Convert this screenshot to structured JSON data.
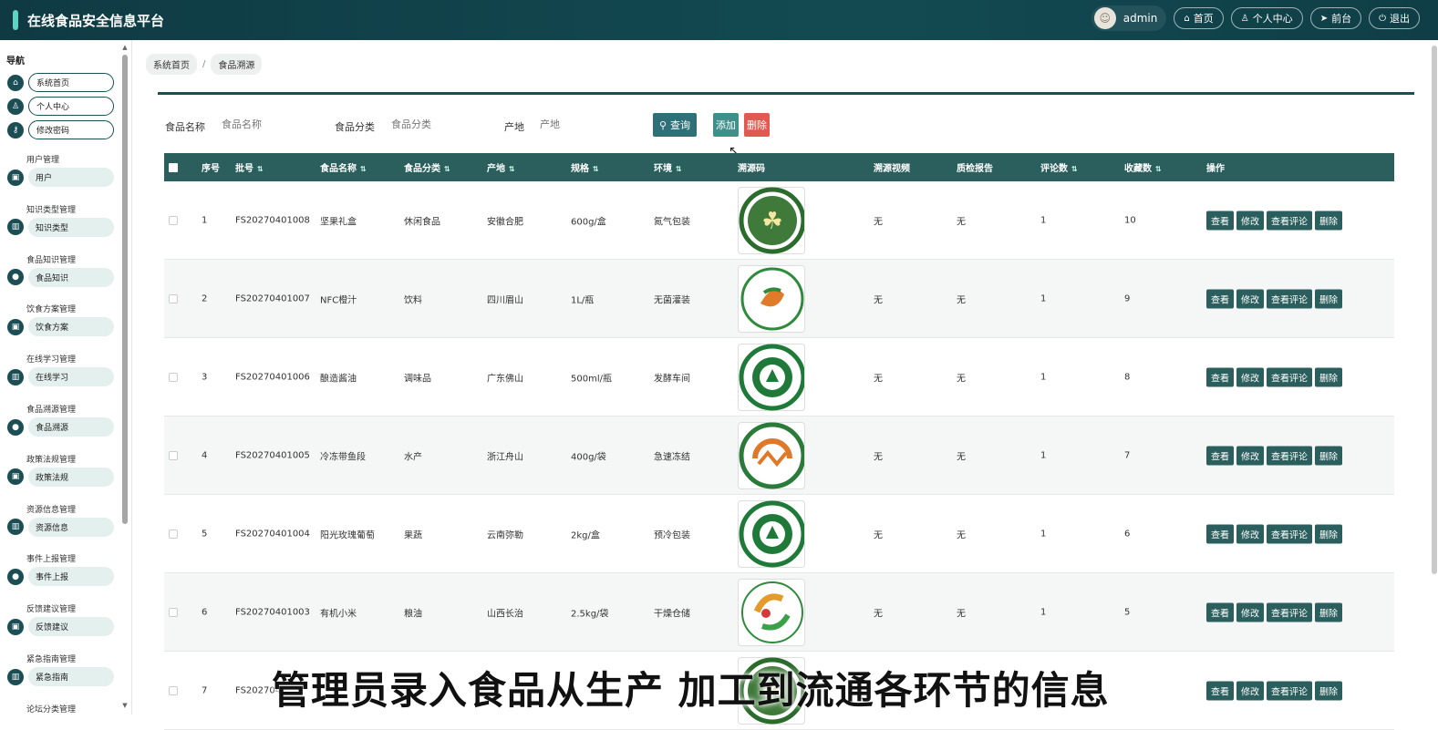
{
  "app": {
    "title": "在线食品安全信息平台"
  },
  "header": {
    "user": "admin",
    "buttons": [
      {
        "icon": "home-icon",
        "label": "首页"
      },
      {
        "icon": "user-icon",
        "label": "个人中心"
      },
      {
        "icon": "send-icon",
        "label": "前台"
      },
      {
        "icon": "power-icon",
        "label": "退出"
      }
    ]
  },
  "sidebar": {
    "title": "导航",
    "top_items": [
      "系统首页",
      "个人中心",
      "修改密码"
    ],
    "groups": [
      {
        "title": "用户管理",
        "item": "用户"
      },
      {
        "title": "知识类型管理",
        "item": "知识类型"
      },
      {
        "title": "食品知识管理",
        "item": "食品知识"
      },
      {
        "title": "饮食方案管理",
        "item": "饮食方案"
      },
      {
        "title": "在线学习管理",
        "item": "在线学习"
      },
      {
        "title": "食品溯源管理",
        "item": "食品溯源"
      },
      {
        "title": "政策法规管理",
        "item": "政策法规"
      },
      {
        "title": "资源信息管理",
        "item": "资源信息"
      },
      {
        "title": "事件上报管理",
        "item": "事件上报"
      },
      {
        "title": "反馈建议管理",
        "item": "反馈建议"
      },
      {
        "title": "紧急指南管理",
        "item": "紧急指南"
      },
      {
        "title": "论坛分类管理",
        "item": ""
      }
    ]
  },
  "breadcrumb": {
    "home": "系统首页",
    "sep": "/",
    "current": "食品溯源"
  },
  "filters": {
    "name_label": "食品名称",
    "name_placeholder": "食品名称",
    "category_label": "食品分类",
    "category_placeholder": "食品分类",
    "origin_label": "产地",
    "origin_placeholder": "产地",
    "query": "查询",
    "add": "添加",
    "delete": "删除"
  },
  "table": {
    "headers": [
      "序号",
      "批号",
      "食品名称",
      "食品分类",
      "产地",
      "规格",
      "环境",
      "溯源码",
      "溯源视频",
      "质检报告",
      "评论数",
      "收藏数",
      "操作"
    ],
    "ops": [
      "查看",
      "修改",
      "查看评论",
      "删除"
    ],
    "rows": [
      {
        "no": "1",
        "batch": "FS20270401008",
        "name": "坚果礼盒",
        "cat": "休闲食品",
        "origin": "安徽合肥",
        "spec": "600g/盒",
        "env": "氮气包装",
        "video": "无",
        "report": "无",
        "comments": "1",
        "favs": "10",
        "badge": "green-round"
      },
      {
        "no": "2",
        "batch": "FS20270401007",
        "name": "NFC橙汁",
        "cat": "饮料",
        "origin": "四川眉山",
        "spec": "1L/瓶",
        "env": "无菌灌装",
        "video": "无",
        "report": "无",
        "comments": "1",
        "favs": "9",
        "badge": "leaf"
      },
      {
        "no": "3",
        "batch": "FS20270401006",
        "name": "酿造酱油",
        "cat": "调味品",
        "origin": "广东佛山",
        "spec": "500ml/瓶",
        "env": "发酵车间",
        "video": "无",
        "report": "无",
        "comments": "1",
        "favs": "8",
        "badge": "emblem"
      },
      {
        "no": "4",
        "batch": "FS20270401005",
        "name": "冷冻带鱼段",
        "cat": "水产",
        "origin": "浙江舟山",
        "spec": "400g/袋",
        "env": "急速冻结",
        "video": "无",
        "report": "无",
        "comments": "1",
        "favs": "7",
        "badge": "orange"
      },
      {
        "no": "5",
        "batch": "FS20270401004",
        "name": "阳光玫瑰葡萄",
        "cat": "果蔬",
        "origin": "云南弥勒",
        "spec": "2kg/盒",
        "env": "预冷包装",
        "video": "无",
        "report": "无",
        "comments": "1",
        "favs": "6",
        "badge": "emblem"
      },
      {
        "no": "6",
        "batch": "FS20270401003",
        "name": "有机小米",
        "cat": "粮油",
        "origin": "山西长治",
        "spec": "2.5kg/袋",
        "env": "干燥仓储",
        "video": "无",
        "report": "无",
        "comments": "1",
        "favs": "5",
        "badge": "colorful"
      },
      {
        "no": "7",
        "batch": "FS2027040",
        "name": "",
        "cat": "",
        "origin": "",
        "spec": "",
        "env": "",
        "video": "",
        "report": "",
        "comments": "",
        "favs": "",
        "badge": "green-round"
      }
    ]
  },
  "caption": "管理员录入食品从生产 加工到流通各环节的信息"
}
